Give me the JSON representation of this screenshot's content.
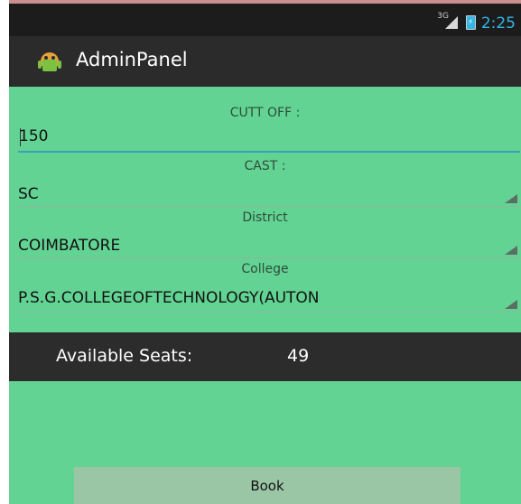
{
  "status_bar": {
    "network_label": "3G",
    "time": "2:25",
    "signal_icon": "signal-icon",
    "battery_icon": "battery-icon"
  },
  "action_bar": {
    "app_icon": "android-icon",
    "title": "AdminPanel"
  },
  "form": {
    "cutoff": {
      "label": "CUTT OFF :",
      "value": "150"
    },
    "cast": {
      "label": "CAST :",
      "selected": "SC"
    },
    "district": {
      "label": "District",
      "selected": "COIMBATORE"
    },
    "college": {
      "label": "College",
      "selected": "P.S.G.COLLEGEOFTECHNOLOGY(AUTON"
    }
  },
  "seats": {
    "label": "Available Seats:",
    "value": "49"
  },
  "book_button": {
    "label": "Book"
  },
  "colors": {
    "background": "#62d393",
    "bars": "#2c2c2c",
    "accent": "#33b5e5",
    "button": "#9bc6a6"
  }
}
